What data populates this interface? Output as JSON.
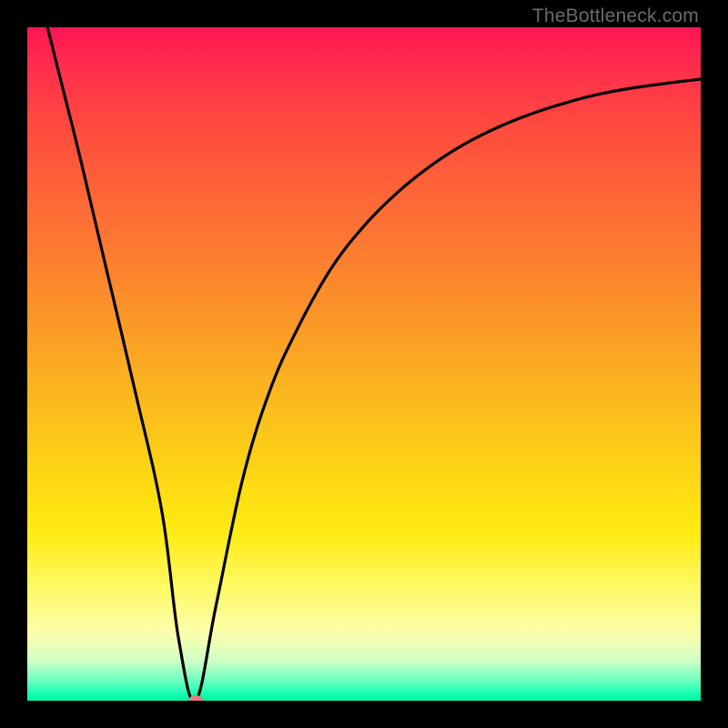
{
  "watermark": "TheBottleneck.com",
  "chart_data": {
    "type": "line",
    "title": "",
    "xlabel": "",
    "ylabel": "",
    "xlim": [
      0,
      100
    ],
    "ylim": [
      0,
      100
    ],
    "series": [
      {
        "name": "bottleneck-curve",
        "x": [
          3,
          5,
          8,
          12,
          16,
          20,
          22.5,
          25,
          28,
          32,
          36,
          40,
          45,
          50,
          55,
          60,
          65,
          70,
          75,
          80,
          85,
          90,
          95,
          100
        ],
        "y": [
          100,
          92,
          80,
          63,
          46,
          28,
          9,
          0,
          14,
          33,
          46,
          55,
          64,
          70.5,
          75.5,
          79.5,
          82.7,
          85.2,
          87.2,
          88.8,
          90.1,
          91,
          91.7,
          92.3
        ]
      }
    ],
    "marker": {
      "x": 25,
      "y": 0,
      "color": "#e87a83"
    },
    "gradient_colors": {
      "top": "#ff1452",
      "mid": "#fbb81e",
      "bottom": "#00f5a0"
    }
  }
}
